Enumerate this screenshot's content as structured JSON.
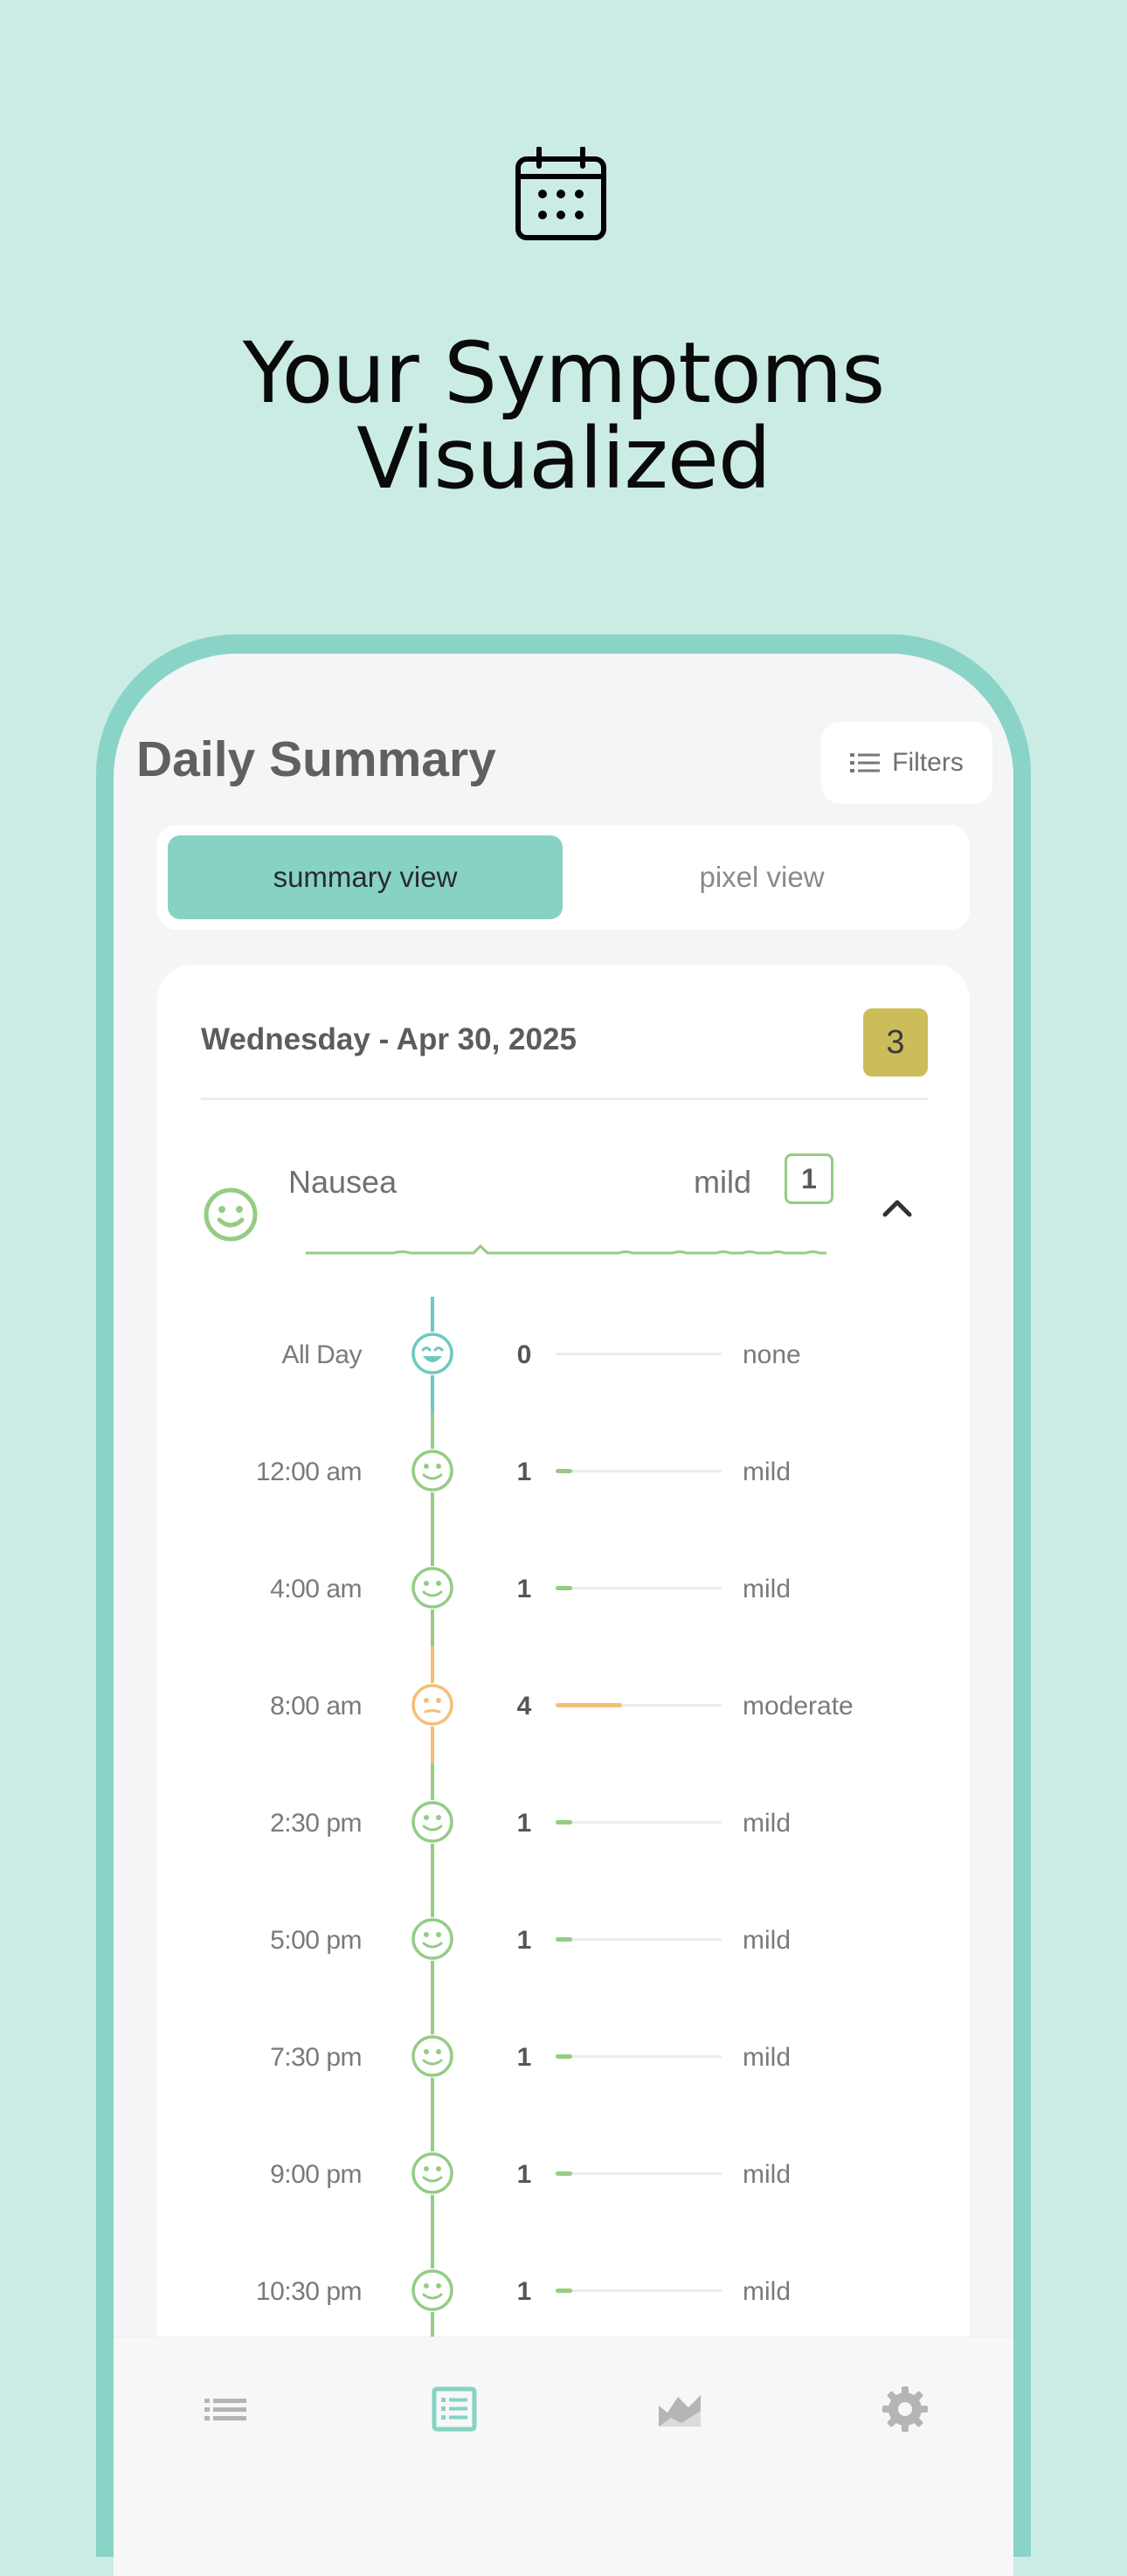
{
  "hero": {
    "icon": "calendar-icon",
    "title_line1": "Your Symptoms",
    "title_line2": "Visualized"
  },
  "screen": {
    "title": "Daily Summary",
    "filters_label": "Filters",
    "filters_icon": "list-icon",
    "view_toggle": {
      "summary": "summary view",
      "pixel": "pixel view",
      "active": "summary"
    }
  },
  "day": {
    "title": "Wednesday - Apr 30, 2025",
    "badge": "3",
    "badge_color": "#cdbd5a"
  },
  "symptom": {
    "name": "Nausea",
    "severity": "mild",
    "score": "1",
    "face_icon": "smile-face-icon",
    "collapse_icon": "chevron-up-icon"
  },
  "timeline": [
    {
      "time": "All Day",
      "value": "0",
      "label": "none",
      "level": 0,
      "color": "#6cc9c2",
      "face": "grin-face-icon"
    },
    {
      "time": "12:00 am",
      "value": "1",
      "label": "mild",
      "level": 1,
      "color": "#94cc84",
      "face": "smile-face-icon"
    },
    {
      "time": "4:00 am",
      "value": "1",
      "label": "mild",
      "level": 1,
      "color": "#94cc84",
      "face": "smile-face-icon"
    },
    {
      "time": "8:00 am",
      "value": "4",
      "label": "moderate",
      "level": 4,
      "color": "#f3c077",
      "face": "neutral-face-icon"
    },
    {
      "time": "2:30 pm",
      "value": "1",
      "label": "mild",
      "level": 1,
      "color": "#94cc84",
      "face": "smile-face-icon"
    },
    {
      "time": "5:00 pm",
      "value": "1",
      "label": "mild",
      "level": 1,
      "color": "#94cc84",
      "face": "smile-face-icon"
    },
    {
      "time": "7:30 pm",
      "value": "1",
      "label": "mild",
      "level": 1,
      "color": "#94cc84",
      "face": "smile-face-icon"
    },
    {
      "time": "9:00 pm",
      "value": "1",
      "label": "mild",
      "level": 1,
      "color": "#94cc84",
      "face": "smile-face-icon"
    },
    {
      "time": "10:30 pm",
      "value": "1",
      "label": "mild",
      "level": 1,
      "color": "#94cc84",
      "face": "smile-face-icon"
    }
  ],
  "bottom_nav": [
    {
      "icon": "list-icon",
      "active": false
    },
    {
      "icon": "daily-summary-icon",
      "active": true
    },
    {
      "icon": "chart-icon",
      "active": false
    },
    {
      "icon": "gear-icon",
      "active": false
    }
  ],
  "colors": {
    "background": "#cbece5",
    "accent": "#86d3c4",
    "mild": "#94cc84",
    "moderate": "#f3c077",
    "none": "#6cc9c2"
  }
}
